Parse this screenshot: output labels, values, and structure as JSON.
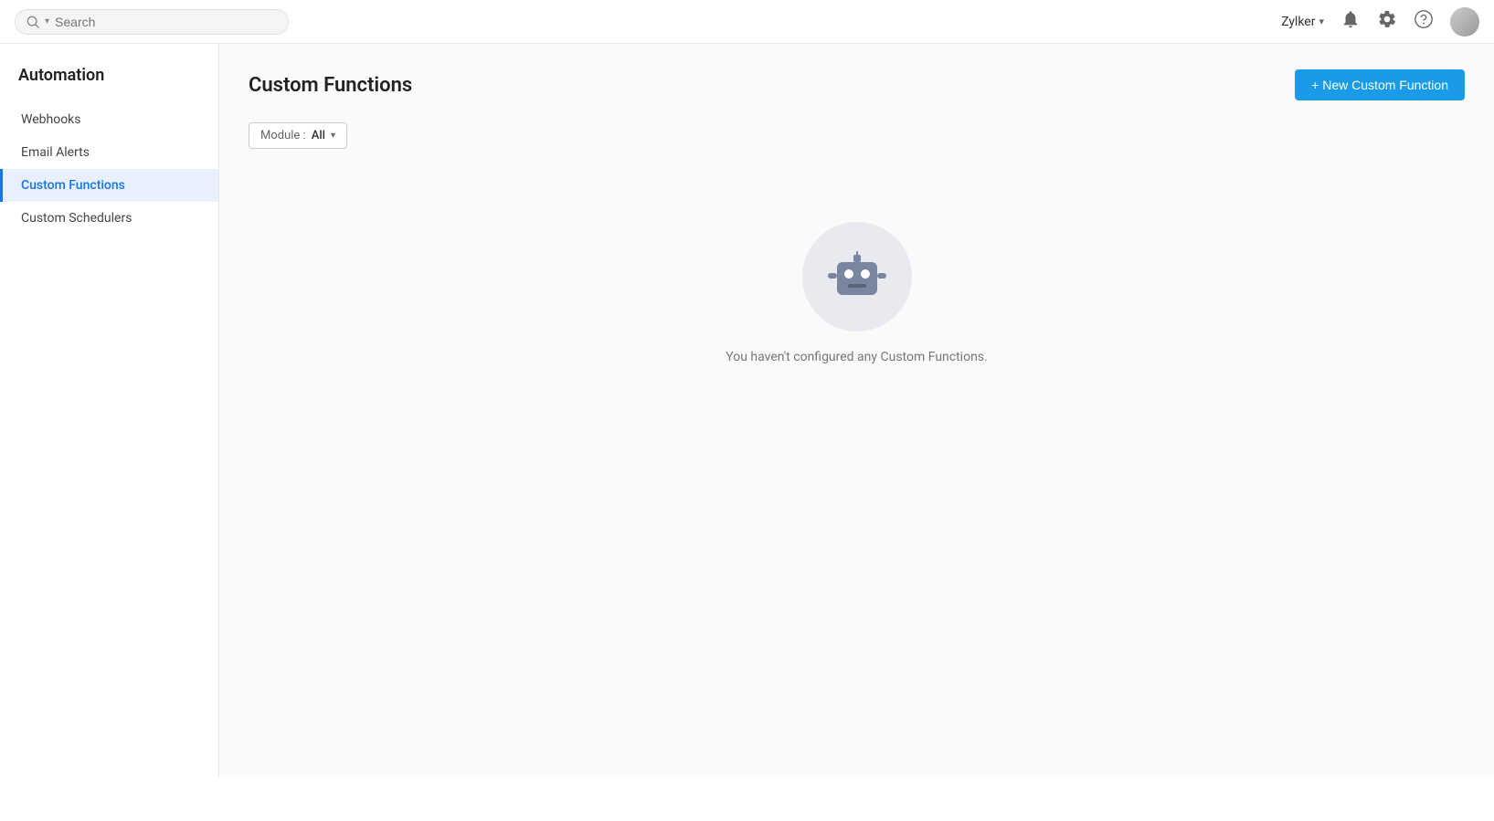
{
  "header": {
    "search_placeholder": "Search",
    "user_name": "Zylker",
    "user_chevron": "▾"
  },
  "sidebar": {
    "title": "Automation",
    "items": [
      {
        "id": "webhooks",
        "label": "Webhooks",
        "active": false
      },
      {
        "id": "email-alerts",
        "label": "Email Alerts",
        "active": false
      },
      {
        "id": "custom-functions",
        "label": "Custom Functions",
        "active": true
      },
      {
        "id": "custom-schedulers",
        "label": "Custom Schedulers",
        "active": false
      }
    ]
  },
  "main": {
    "page_title": "Custom Functions",
    "new_button_label": "+ New Custom Function",
    "filter": {
      "module_label": "Module :",
      "module_value": "All"
    },
    "empty_state": {
      "message": "You haven't configured any Custom Functions."
    }
  },
  "icons": {
    "search": "🔍",
    "bell": "🔔",
    "gear": "⚙",
    "help": "❓",
    "chevron_down": "▾"
  }
}
